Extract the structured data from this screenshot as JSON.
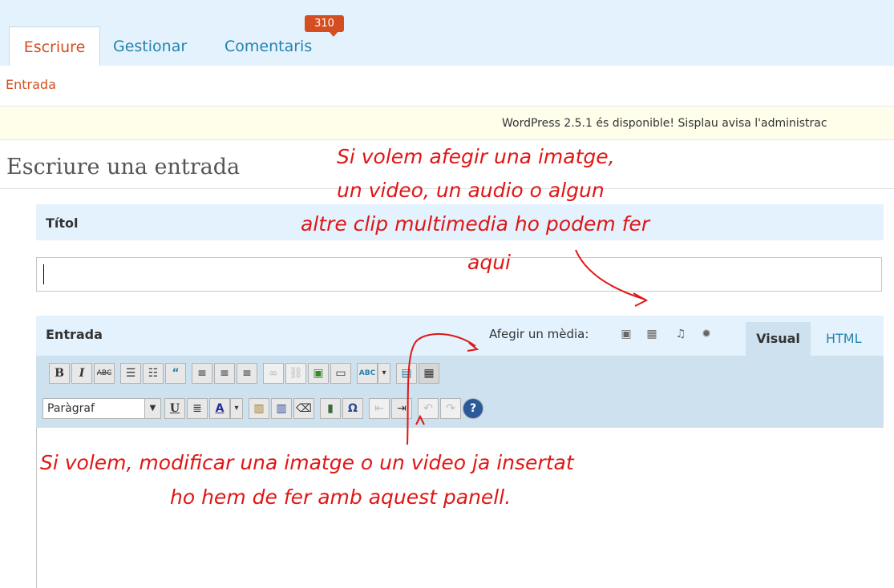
{
  "nav": {
    "tabs": [
      {
        "label": "Escriure"
      },
      {
        "label": "Gestionar"
      },
      {
        "label": "Comentaris"
      }
    ],
    "comment_count": "310",
    "subnav": "Entrada"
  },
  "notice": "WordPress 2.5.1 és disponible! Sisplau avisa l'administrac",
  "page_title": "Escriure una entrada",
  "title_box": {
    "label": "Títol",
    "value": ""
  },
  "entry_box": {
    "label": "Entrada",
    "media_label": "Afegir un mèdia:",
    "tabs": {
      "visual": "Visual",
      "html": "HTML"
    },
    "format_select": "Paràgraf"
  },
  "toolbar": {
    "row1": [
      "B",
      "I",
      "ABC",
      "☰",
      "☷",
      "“",
      "≡",
      "≡",
      "≡",
      "∞",
      "⛓",
      "▣",
      "▭",
      "ABC",
      "▾",
      "▤",
      "▦"
    ],
    "row2": [
      "U",
      "≣",
      "A",
      "▾",
      "▥",
      "▥",
      "⌫",
      "▮",
      "Ω",
      "⇤",
      "⇥",
      "↶",
      "↷",
      "?"
    ]
  },
  "annotations": {
    "top": [
      "Si volem afegir una imatge,",
      "un video, un audio o algun",
      "altre clip multimedia ho podem fer",
      "aqui"
    ],
    "bottom": [
      "Si volem, modificar una imatge o un video ja insertat",
      "ho hem de fer amb aquest panell."
    ]
  },
  "colors": {
    "accent": "#d54e21",
    "link": "#2583ad",
    "header_bg": "#e4f2fd",
    "annotation": "#e01616"
  }
}
